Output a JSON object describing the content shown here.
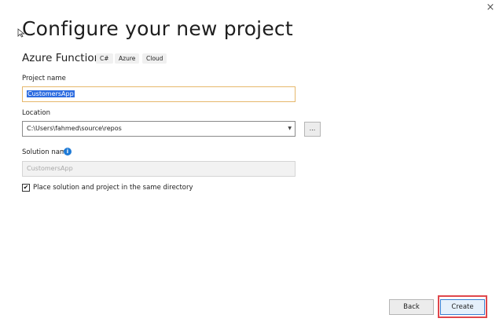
{
  "window": {
    "close_icon": "×"
  },
  "header": {
    "title": "Configure your new project",
    "template_name": "Azure Functions",
    "tags": [
      "C#",
      "Azure",
      "Cloud"
    ]
  },
  "form": {
    "project_name": {
      "label": "Project name",
      "value": "CustomersApp"
    },
    "location": {
      "label": "Location",
      "value": "C:\\Users\\fahmed\\source\\repos",
      "arrow": "▼"
    },
    "browse_label": "...",
    "solution_name": {
      "label": "Solution name",
      "placeholder": "CustomersApp",
      "info_icon": "i"
    },
    "place_in_same_dir": {
      "label": "Place solution and project in the same directory",
      "checked": true,
      "check_mark": "✔"
    }
  },
  "footer": {
    "back_label": "Back",
    "create_label": "Create"
  },
  "colors": {
    "accent": "#2d6ce0",
    "info": "#1e7ad6",
    "highlight": "#e0474c",
    "focus_border": "#e6b86c"
  }
}
